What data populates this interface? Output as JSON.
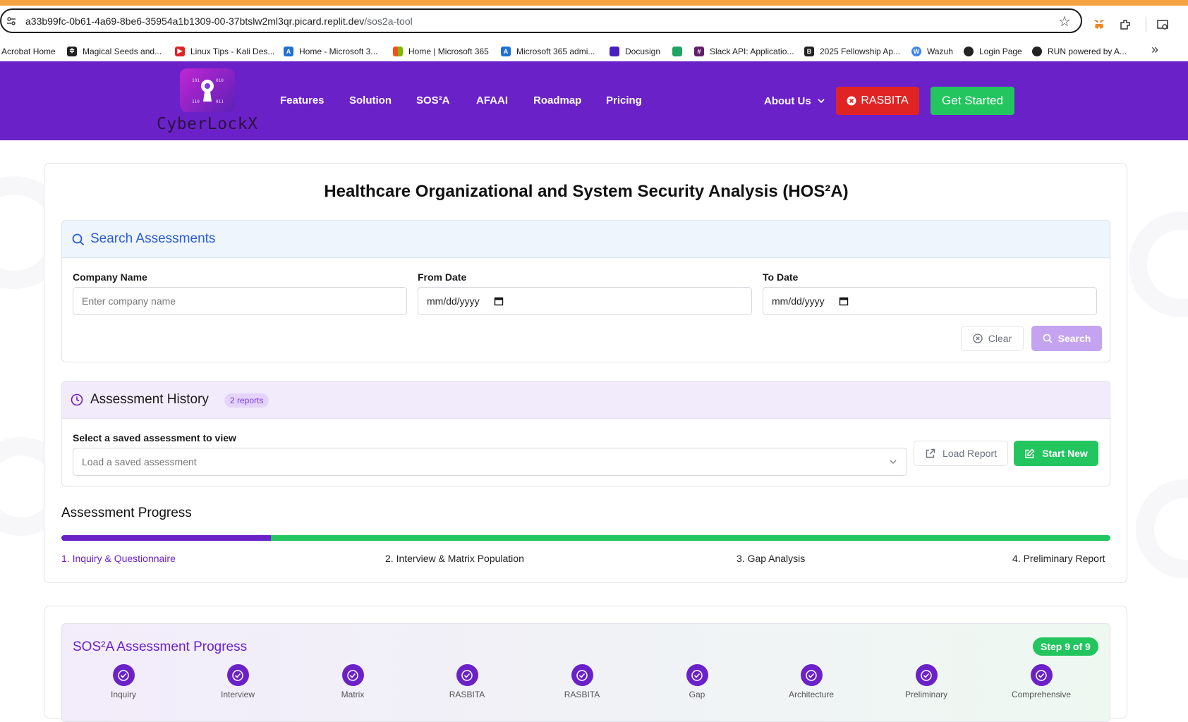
{
  "browser": {
    "url_host": "a33b99fc-0b61-4a69-8be6-35954a1b1309-00-37btslw2ml3qr.picard.replit.dev",
    "url_path": "/sos2a-tool",
    "bookmarks": [
      {
        "label": "Acrobat Home",
        "icon": "acrobat-icon",
        "color": "#ffffff"
      },
      {
        "label": "Magical Seeds and...",
        "icon": "seed-icon",
        "color": "#222222"
      },
      {
        "label": "Linux Tips - Kali Des...",
        "icon": "youtube-icon",
        "color": "#e02424"
      },
      {
        "label": "Home - Microsoft 3...",
        "icon": "azure-icon",
        "color": "#1f6fd6"
      },
      {
        "label": "Home | Microsoft 365",
        "icon": "microsoft-icon",
        "color": "#f25022"
      },
      {
        "label": "Microsoft 365 admi...",
        "icon": "azure-icon",
        "color": "#1f6fd6"
      },
      {
        "label": "Docusign",
        "icon": "docusign-icon",
        "color": "#4b1fbf"
      },
      {
        "label": "",
        "icon": "meet-icon",
        "color": "#1fa463"
      },
      {
        "label": "Slack API: Applicatio...",
        "icon": "slack-icon",
        "color": "#611f69"
      },
      {
        "label": "2025 Fellowship Ap...",
        "icon": "bold-b-icon",
        "color": "#222222"
      },
      {
        "label": "Wazuh",
        "icon": "wazuh-icon",
        "color": "#3b82f6"
      },
      {
        "label": "Login Page",
        "icon": "globe-icon",
        "color": "#222222"
      },
      {
        "label": "RUN powered by A...",
        "icon": "globe-icon",
        "color": "#222222"
      }
    ]
  },
  "header": {
    "logo_text": "CyberLockX",
    "nav": [
      "Features",
      "Solution",
      "SOS²A",
      "AFAAI",
      "Roadmap",
      "Pricing"
    ],
    "about": "About Us",
    "rasbita": "RASBITA",
    "get_started": "Get Started"
  },
  "page": {
    "title": "Healthcare Organizational and System Security Analysis (HOS²A)"
  },
  "search": {
    "title": "Search Assessments",
    "company_label": "Company Name",
    "company_placeholder": "Enter company name",
    "from_label": "From Date",
    "from_value": "mm/dd/yyyy",
    "to_label": "To Date",
    "to_value": "mm/dd/yyyy",
    "clear": "Clear",
    "search": "Search"
  },
  "history": {
    "title": "Assessment History",
    "badge": "2 reports",
    "select_label": "Select a saved assessment to view",
    "select_placeholder": "Load a saved assessment",
    "load": "Load Report",
    "start_new": "Start New"
  },
  "progress": {
    "title": "Assessment Progress",
    "completed_fraction": 0.2,
    "steps": [
      "1. Inquiry & Questionnaire",
      "2. Interview & Matrix Population",
      "3. Gap Analysis",
      "4. Preliminary Report"
    ]
  },
  "sos": {
    "title": "SOS²A Assessment Progress",
    "badge": "Step 9 of 9",
    "steps": [
      "Inquiry",
      "Interview",
      "Matrix",
      "RASBITA",
      "RASBITA",
      "Gap",
      "Architecture",
      "Preliminary",
      "Comprehensive"
    ]
  },
  "colors": {
    "brand_purple": "#6b21c8",
    "accent_green": "#22c55e",
    "danger_red": "#e02424",
    "search_blue": "#2a5bd7"
  }
}
